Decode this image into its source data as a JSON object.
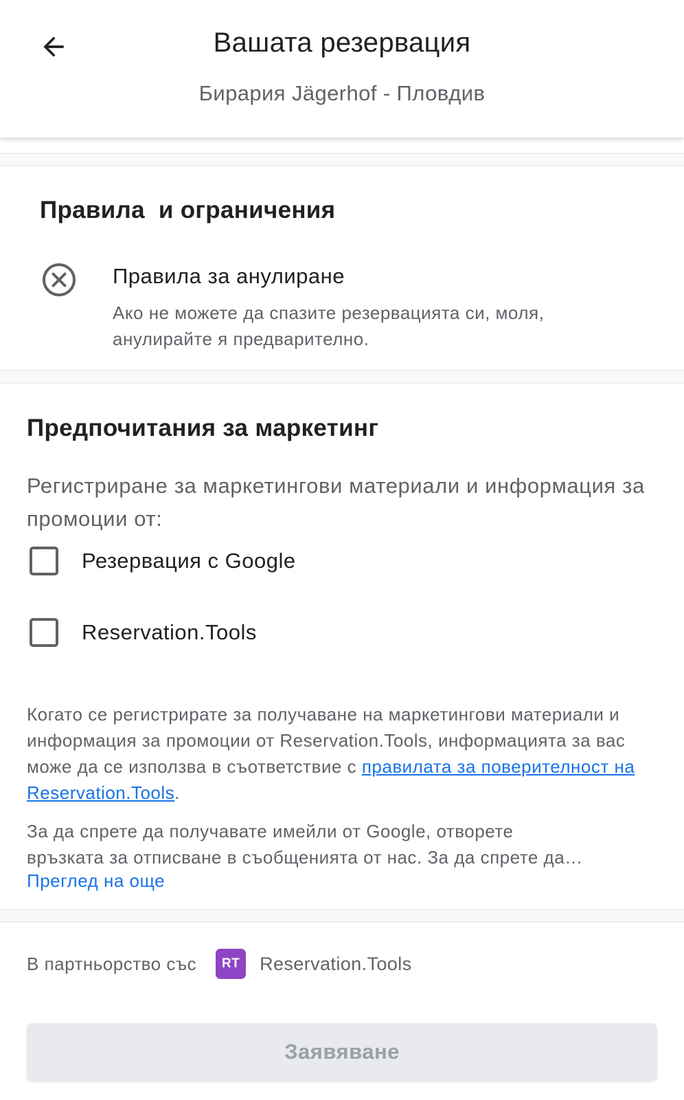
{
  "header": {
    "title": "Вашата резервация",
    "subtitle": "Бирария Jägerhof - Пловдив",
    "back_icon": "arrow-back-icon"
  },
  "rules": {
    "heading": "Правила  и ограничения",
    "cancellation": {
      "icon": "cancel-circle-icon",
      "title": "Правила за анулиране",
      "description": "Ако не можете да спазите резервацията си, моля, анулирайте я предварително."
    }
  },
  "marketing": {
    "heading": "Предпочитания за маркетинг",
    "intro": "Регистриране за маркетингови материали и информация за промоции от:",
    "options": [
      {
        "label": "Резервация с Google",
        "checked": false
      },
      {
        "label": "Reservation.Tools",
        "checked": false
      }
    ],
    "privacy_text_before": "Когато се регистрирате за получаване на маркетингови материали и информация за промоции от Reservation.Tools, информацията за вас може да се използва в съответствие с ",
    "privacy_link": "правилата за поверителност на Reservation.Tools",
    "privacy_text_after": ".",
    "unsubscribe_line1": "За да спрете да получавате имейли от Google, отворете",
    "unsubscribe_line2": "връзката за отписване в съобщенията от нас. За да спрете да…",
    "see_more": "Преглед на още"
  },
  "partner": {
    "label": "В партньорство със",
    "logo_text": "RT",
    "logo_color": "#8e44c4",
    "name": "Reservation.Tools"
  },
  "submit": {
    "label": "Заявяване",
    "disabled": true
  },
  "colors": {
    "link": "#1a73e8",
    "secondary_text": "#5f6368",
    "primary_text": "#202124"
  }
}
